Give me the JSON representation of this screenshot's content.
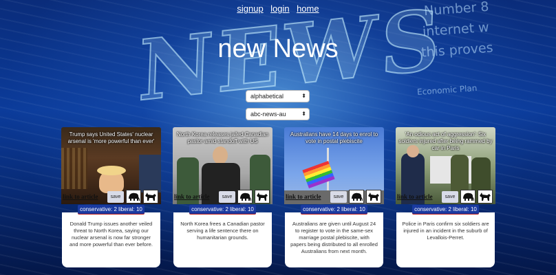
{
  "nav": {
    "signup": "signup",
    "login": "login",
    "home": "home"
  },
  "title": "new News",
  "filters": {
    "sort": "alphabetical",
    "source": "abc-news-au"
  },
  "background": {
    "word": "NEWS",
    "side": [
      "Number 8",
      "internet w",
      "this proves",
      "Economic Plan"
    ]
  },
  "articles": [
    {
      "headline": "Trump says United States' nuclear arsenal is 'more powerful than ever'",
      "link": "link to article",
      "save": "save",
      "score": "conservative: 2 liberal: 10",
      "description": "Donald Trump issues another veiled threat to North Korea, saying our nuclear arsenal is now far stronger and more powerful than ever before."
    },
    {
      "headline": "North Korea releases jailed Canadian pastor amid standoff with US",
      "link": "link to article",
      "save": "save",
      "score": "conservative: 2 liberal: 10",
      "description": "North Korea frees a Canadian pastor serving a life sentence there on humanitarian grounds."
    },
    {
      "headline": "Australians have 14 days to enrol to vote in postal plebiscite",
      "link": "link to article",
      "save": "save",
      "score": "conservative: 2 liberal: 10",
      "description": "Australians are given until August 24 to register to vote in the same-sex marriage postal plebiscite, with papers being distributed to all enrolled Australians from next month."
    },
    {
      "headline": "'An odious act of aggression': Six soldiers injured after being rammed by car in Paris",
      "link": "link to article",
      "save": "save",
      "score": "conservative: 2 liberal: 10",
      "description": "Police in Paris confirm six soldiers are injured in an incident in the suburb of Levallois-Perret."
    }
  ],
  "colors": {
    "score_bg": "#1a3aa0",
    "score_border": "#b31515",
    "bg": "#0b3b9a"
  },
  "icons": {
    "elephant": "elephant-icon",
    "donkey": "donkey-icon",
    "chevron": "chevron-updown-icon"
  }
}
